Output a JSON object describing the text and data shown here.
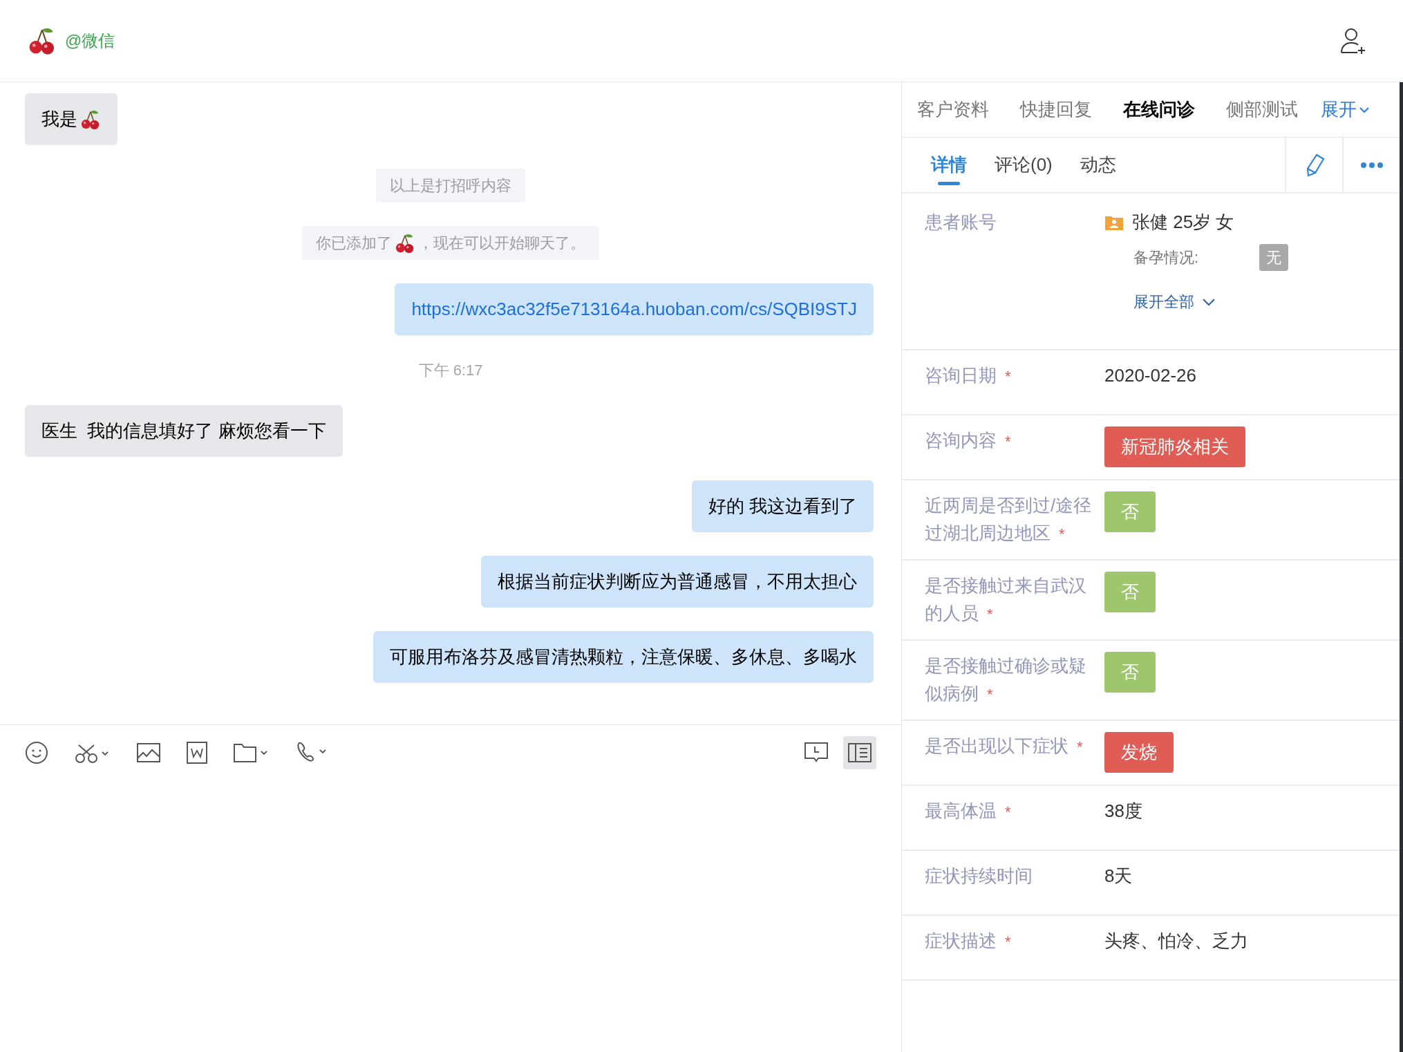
{
  "header": {
    "title": "@微信"
  },
  "chat": {
    "messages": [
      {
        "kind": "incoming",
        "parts": [
          {
            "kind": "text",
            "text": "我是"
          },
          {
            "kind": "cherry"
          }
        ]
      },
      {
        "kind": "notice",
        "parts": [
          {
            "kind": "text",
            "text": "以上是打招呼内容"
          }
        ]
      },
      {
        "kind": "notice",
        "parts": [
          {
            "kind": "text",
            "text": "你已添加了"
          },
          {
            "kind": "cherry"
          },
          {
            "kind": "text",
            "text": "，现在可以开始聊天了。"
          }
        ]
      },
      {
        "kind": "outgoing",
        "parts": [
          {
            "kind": "link",
            "text": "https://wxc3ac32f5e713164a.huoban.com/cs/SQBI9STJ"
          }
        ]
      },
      {
        "kind": "time",
        "parts": [
          {
            "kind": "text",
            "text": "下午 6:17"
          }
        ]
      },
      {
        "kind": "incoming",
        "parts": [
          {
            "kind": "text",
            "text": "医生  我的信息填好了 麻烦您看一下"
          }
        ]
      },
      {
        "kind": "outgoing",
        "parts": [
          {
            "kind": "text",
            "text": "好的 我这边看到了"
          }
        ]
      },
      {
        "kind": "outgoing",
        "parts": [
          {
            "kind": "text",
            "text": "根据当前症状判断应为普通感冒，不用太担心"
          }
        ]
      },
      {
        "kind": "outgoing",
        "parts": [
          {
            "kind": "text",
            "text": "可服用布洛芬及感冒清热颗粒，注意保暖、多休息、多喝水"
          }
        ]
      }
    ],
    "side_panel_button": {
      "selected": true
    }
  },
  "panel": {
    "tabs": [
      {
        "label": "客户资料",
        "selected": false
      },
      {
        "label": "快捷回复",
        "selected": false
      },
      {
        "label": "在线问诊",
        "selected": true
      },
      {
        "label": "侧部测试",
        "selected": false
      }
    ],
    "expand": "展开",
    "subtabs": [
      {
        "label": "详情",
        "selected": true
      },
      {
        "label": "评论(0)",
        "selected": false
      },
      {
        "label": "动态",
        "selected": false
      }
    ],
    "patient": {
      "label": "患者账号",
      "value": "张健 25岁 女",
      "sub_label": "备孕情况:",
      "sub_value": "无",
      "expand_all": "展开全部"
    },
    "fields": [
      {
        "label": "咨询日期",
        "required_mark": "*",
        "kind": "text",
        "value": "2020-02-26"
      },
      {
        "label": "咨询内容",
        "required_mark": "*",
        "kind": "tag",
        "value": "新冠肺炎相关",
        "color": "#e05d55"
      },
      {
        "label": "近两周是否到过/途径过湖北周边地区",
        "required_mark": "*",
        "kind": "tag",
        "value": "否",
        "color": "#9dc66d"
      },
      {
        "label": "是否接触过来自武汉的人员",
        "required_mark": "*",
        "kind": "tag",
        "value": "否",
        "color": "#9dc66d"
      },
      {
        "label": "是否接触过确诊或疑似病例",
        "required_mark": "*",
        "kind": "tag",
        "value": "否",
        "color": "#9dc66d"
      },
      {
        "label": "是否出现以下症状",
        "required_mark": "*",
        "kind": "tag",
        "value": "发烧",
        "color": "#e05d55"
      },
      {
        "label": "最高体温",
        "required_mark": "*",
        "kind": "text",
        "value": "38度"
      },
      {
        "label": "症状持续时间",
        "kind": "text",
        "value": "8天"
      },
      {
        "label": "症状描述",
        "required_mark": "*",
        "kind": "text",
        "value": "头疼、怕冷、乏力"
      }
    ]
  }
}
